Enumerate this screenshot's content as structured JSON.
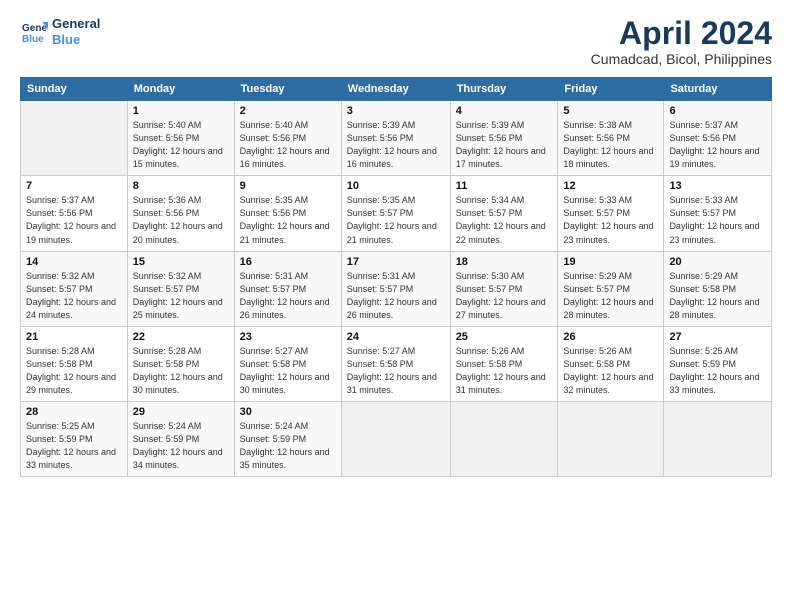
{
  "header": {
    "logo_line1": "General",
    "logo_line2": "Blue",
    "month_title": "April 2024",
    "location": "Cumadcad, Bicol, Philippines"
  },
  "days_of_week": [
    "Sunday",
    "Monday",
    "Tuesday",
    "Wednesday",
    "Thursday",
    "Friday",
    "Saturday"
  ],
  "weeks": [
    [
      {
        "day": "",
        "info": ""
      },
      {
        "day": "1",
        "info": "Sunrise: 5:40 AM\nSunset: 5:56 PM\nDaylight: 12 hours\nand 15 minutes."
      },
      {
        "day": "2",
        "info": "Sunrise: 5:40 AM\nSunset: 5:56 PM\nDaylight: 12 hours\nand 16 minutes."
      },
      {
        "day": "3",
        "info": "Sunrise: 5:39 AM\nSunset: 5:56 PM\nDaylight: 12 hours\nand 16 minutes."
      },
      {
        "day": "4",
        "info": "Sunrise: 5:39 AM\nSunset: 5:56 PM\nDaylight: 12 hours\nand 17 minutes."
      },
      {
        "day": "5",
        "info": "Sunrise: 5:38 AM\nSunset: 5:56 PM\nDaylight: 12 hours\nand 18 minutes."
      },
      {
        "day": "6",
        "info": "Sunrise: 5:37 AM\nSunset: 5:56 PM\nDaylight: 12 hours\nand 19 minutes."
      }
    ],
    [
      {
        "day": "7",
        "info": "Sunrise: 5:37 AM\nSunset: 5:56 PM\nDaylight: 12 hours\nand 19 minutes."
      },
      {
        "day": "8",
        "info": "Sunrise: 5:36 AM\nSunset: 5:56 PM\nDaylight: 12 hours\nand 20 minutes."
      },
      {
        "day": "9",
        "info": "Sunrise: 5:35 AM\nSunset: 5:56 PM\nDaylight: 12 hours\nand 21 minutes."
      },
      {
        "day": "10",
        "info": "Sunrise: 5:35 AM\nSunset: 5:57 PM\nDaylight: 12 hours\nand 21 minutes."
      },
      {
        "day": "11",
        "info": "Sunrise: 5:34 AM\nSunset: 5:57 PM\nDaylight: 12 hours\nand 22 minutes."
      },
      {
        "day": "12",
        "info": "Sunrise: 5:33 AM\nSunset: 5:57 PM\nDaylight: 12 hours\nand 23 minutes."
      },
      {
        "day": "13",
        "info": "Sunrise: 5:33 AM\nSunset: 5:57 PM\nDaylight: 12 hours\nand 23 minutes."
      }
    ],
    [
      {
        "day": "14",
        "info": "Sunrise: 5:32 AM\nSunset: 5:57 PM\nDaylight: 12 hours\nand 24 minutes."
      },
      {
        "day": "15",
        "info": "Sunrise: 5:32 AM\nSunset: 5:57 PM\nDaylight: 12 hours\nand 25 minutes."
      },
      {
        "day": "16",
        "info": "Sunrise: 5:31 AM\nSunset: 5:57 PM\nDaylight: 12 hours\nand 26 minutes."
      },
      {
        "day": "17",
        "info": "Sunrise: 5:31 AM\nSunset: 5:57 PM\nDaylight: 12 hours\nand 26 minutes."
      },
      {
        "day": "18",
        "info": "Sunrise: 5:30 AM\nSunset: 5:57 PM\nDaylight: 12 hours\nand 27 minutes."
      },
      {
        "day": "19",
        "info": "Sunrise: 5:29 AM\nSunset: 5:57 PM\nDaylight: 12 hours\nand 28 minutes."
      },
      {
        "day": "20",
        "info": "Sunrise: 5:29 AM\nSunset: 5:58 PM\nDaylight: 12 hours\nand 28 minutes."
      }
    ],
    [
      {
        "day": "21",
        "info": "Sunrise: 5:28 AM\nSunset: 5:58 PM\nDaylight: 12 hours\nand 29 minutes."
      },
      {
        "day": "22",
        "info": "Sunrise: 5:28 AM\nSunset: 5:58 PM\nDaylight: 12 hours\nand 30 minutes."
      },
      {
        "day": "23",
        "info": "Sunrise: 5:27 AM\nSunset: 5:58 PM\nDaylight: 12 hours\nand 30 minutes."
      },
      {
        "day": "24",
        "info": "Sunrise: 5:27 AM\nSunset: 5:58 PM\nDaylight: 12 hours\nand 31 minutes."
      },
      {
        "day": "25",
        "info": "Sunrise: 5:26 AM\nSunset: 5:58 PM\nDaylight: 12 hours\nand 31 minutes."
      },
      {
        "day": "26",
        "info": "Sunrise: 5:26 AM\nSunset: 5:58 PM\nDaylight: 12 hours\nand 32 minutes."
      },
      {
        "day": "27",
        "info": "Sunrise: 5:25 AM\nSunset: 5:59 PM\nDaylight: 12 hours\nand 33 minutes."
      }
    ],
    [
      {
        "day": "28",
        "info": "Sunrise: 5:25 AM\nSunset: 5:59 PM\nDaylight: 12 hours\nand 33 minutes."
      },
      {
        "day": "29",
        "info": "Sunrise: 5:24 AM\nSunset: 5:59 PM\nDaylight: 12 hours\nand 34 minutes."
      },
      {
        "day": "30",
        "info": "Sunrise: 5:24 AM\nSunset: 5:59 PM\nDaylight: 12 hours\nand 35 minutes."
      },
      {
        "day": "",
        "info": ""
      },
      {
        "day": "",
        "info": ""
      },
      {
        "day": "",
        "info": ""
      },
      {
        "day": "",
        "info": ""
      }
    ]
  ]
}
